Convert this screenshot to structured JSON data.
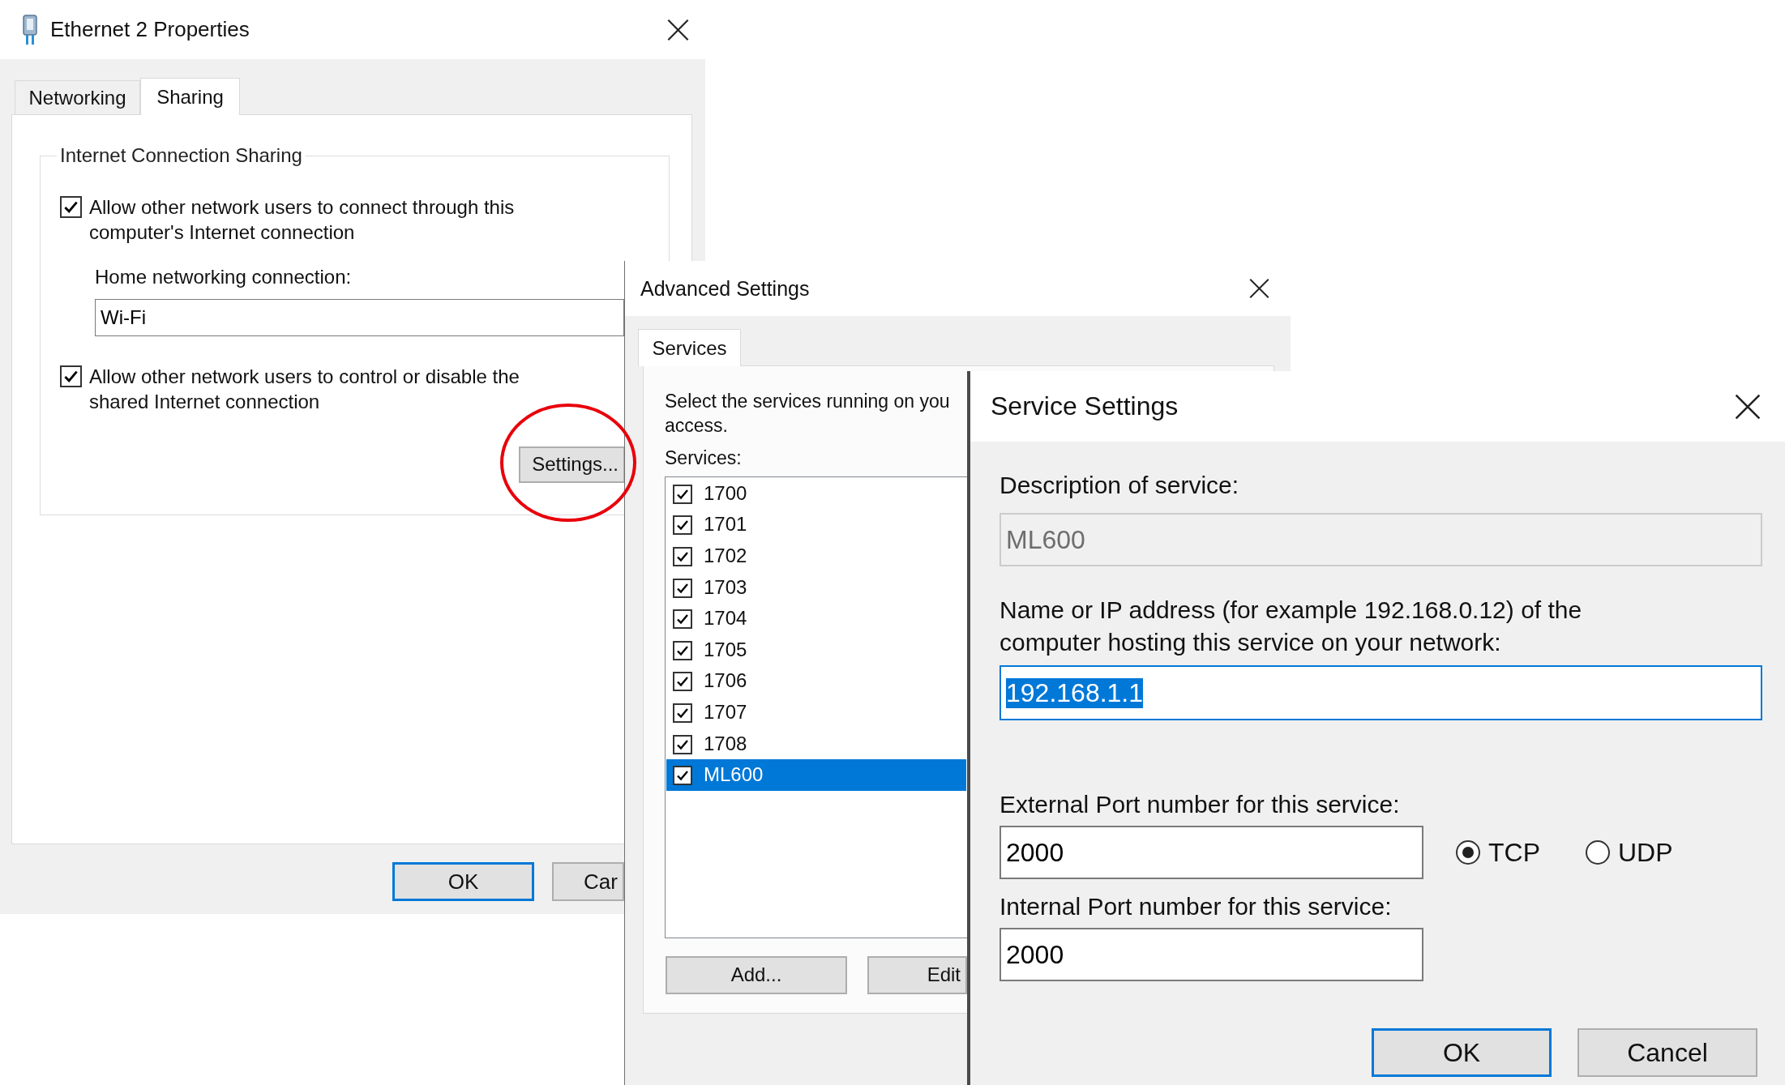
{
  "ethernet_properties": {
    "title": "Ethernet 2 Properties",
    "tabs": [
      {
        "label": "Networking",
        "selected": false
      },
      {
        "label": "Sharing",
        "selected": true
      }
    ],
    "group_title": "Internet Connection Sharing",
    "allow_connect": {
      "label": "Allow other network users to connect through this computer's Internet connection",
      "checked": true
    },
    "home_connection": {
      "label": "Home networking connection:",
      "value": "Wi-Fi"
    },
    "allow_control": {
      "label": "Allow other network users to control or disable the shared Internet connection",
      "checked": true
    },
    "settings_button": "Settings...",
    "buttons": [
      {
        "label": "OK",
        "default": true
      },
      {
        "label": "Car",
        "default": false
      }
    ]
  },
  "advanced_settings": {
    "title": "Advanced Settings",
    "tabs": [
      {
        "label": "Services",
        "selected": true
      }
    ],
    "intro": "Select the services running on you\naccess.",
    "services_label": "Services:",
    "services": [
      {
        "label": "1700",
        "checked": true,
        "selected": false
      },
      {
        "label": "1701",
        "checked": true,
        "selected": false
      },
      {
        "label": "1702",
        "checked": true,
        "selected": false
      },
      {
        "label": "1703",
        "checked": true,
        "selected": false
      },
      {
        "label": "1704",
        "checked": true,
        "selected": false
      },
      {
        "label": "1705",
        "checked": true,
        "selected": false
      },
      {
        "label": "1706",
        "checked": true,
        "selected": false
      },
      {
        "label": "1707",
        "checked": true,
        "selected": false
      },
      {
        "label": "1708",
        "checked": true,
        "selected": false
      },
      {
        "label": "ML600",
        "checked": true,
        "selected": true
      }
    ],
    "buttons": [
      "Add...",
      "Edit"
    ]
  },
  "service_settings": {
    "title": "Service Settings",
    "description": {
      "label": "Description of service:",
      "value": "ML600",
      "disabled": true
    },
    "host": {
      "label": "Name or IP address (for example 192.168.0.12) of the computer hosting this service on your network:",
      "value": "192.168.1.1",
      "value_selected": true
    },
    "external_port": {
      "label": "External Port number for this service:",
      "value": "2000"
    },
    "protocols": [
      {
        "label": "TCP",
        "selected": true
      },
      {
        "label": "UDP",
        "selected": false
      }
    ],
    "internal_port": {
      "label": "Internal Port number for this service:",
      "value": "2000"
    },
    "buttons": [
      {
        "label": "OK",
        "default": true
      },
      {
        "label": "Cancel",
        "default": false
      }
    ]
  }
}
